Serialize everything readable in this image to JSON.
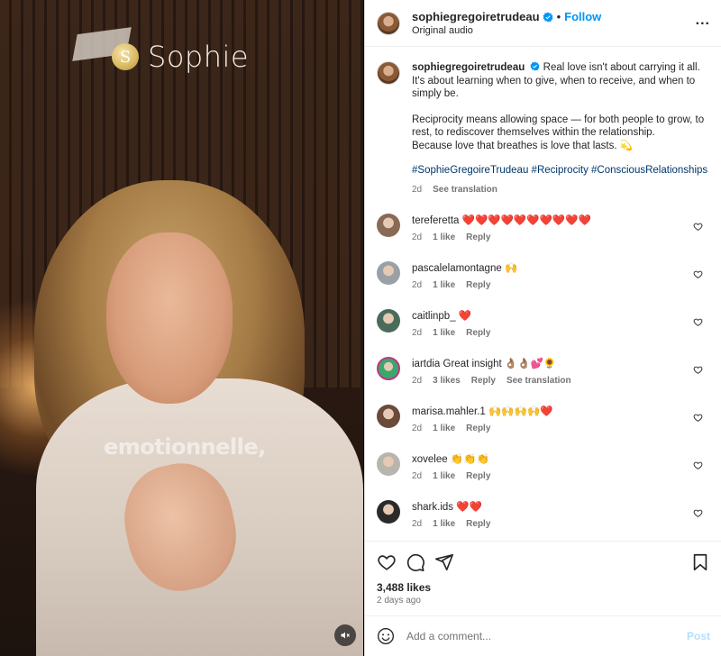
{
  "video": {
    "title": "Sophie",
    "coin_glyph": "S",
    "caption": "emotionnelle,",
    "mute_icon": "speaker-muted-icon"
  },
  "header": {
    "username": "sophiegregoiretrudeau",
    "dot": "•",
    "follow": "Follow",
    "audio": "Original audio",
    "more": "..."
  },
  "post": {
    "username": "sophiegregoiretrudeau",
    "para1": "Real love isn't about carrying it all. It's about learning when to give, when to receive, and when to simply be.",
    "para2a": "Reciprocity means allowing space — for both people to grow, to rest, to rediscover themselves within the relationship.",
    "para2b": "Because love that breathes is love that lasts. 💫",
    "hashtags": "#SophieGregoireTrudeau #Reciprocity #ConsciousRelationships",
    "time": "2d",
    "see_translation": "See translation"
  },
  "comments": [
    {
      "user": "tereferetta",
      "text": "❤️❤️❤️❤️❤️❤️❤️❤️❤️❤️",
      "time": "2d",
      "likes": "1 like",
      "reply": "Reply",
      "extra": "",
      "avatar": "#8a6a55"
    },
    {
      "user": "pascalelamontagne",
      "text": "🙌",
      "time": "2d",
      "likes": "1 like",
      "reply": "Reply",
      "extra": "",
      "avatar": "#9aa0a6"
    },
    {
      "user": "caitlinpb_",
      "text": "❤️",
      "time": "2d",
      "likes": "1 like",
      "reply": "Reply",
      "extra": "",
      "avatar": "#4b6b5a"
    },
    {
      "user": "iartdia",
      "text": "Great insight 👌🏽👌🏽💕🌻",
      "time": "2d",
      "likes": "3 likes",
      "reply": "Reply",
      "extra": "See translation",
      "avatar": "#3aa86b"
    },
    {
      "user": "marisa.mahler.1",
      "text": "🙌🙌🙌🙌❤️",
      "time": "2d",
      "likes": "1 like",
      "reply": "Reply",
      "extra": "",
      "avatar": "#6b4a3a"
    },
    {
      "user": "xovelee",
      "text": "👏👏👏",
      "time": "2d",
      "likes": "1 like",
      "reply": "Reply",
      "extra": "",
      "avatar": "#b8b4ae"
    },
    {
      "user": "shark.ids",
      "text": "❤️❤️",
      "time": "2d",
      "likes": "1 like",
      "reply": "Reply",
      "extra": "",
      "avatar": "#2a2a2a"
    }
  ],
  "footer": {
    "likes": "3,488 likes",
    "ago": "2 days ago",
    "comment_placeholder": "Add a comment...",
    "post": "Post"
  },
  "colors": {
    "accent": "#0095f6",
    "post_disabled": "#b2dffc",
    "muted_text": "#737373",
    "hashtag": "#00376b"
  }
}
